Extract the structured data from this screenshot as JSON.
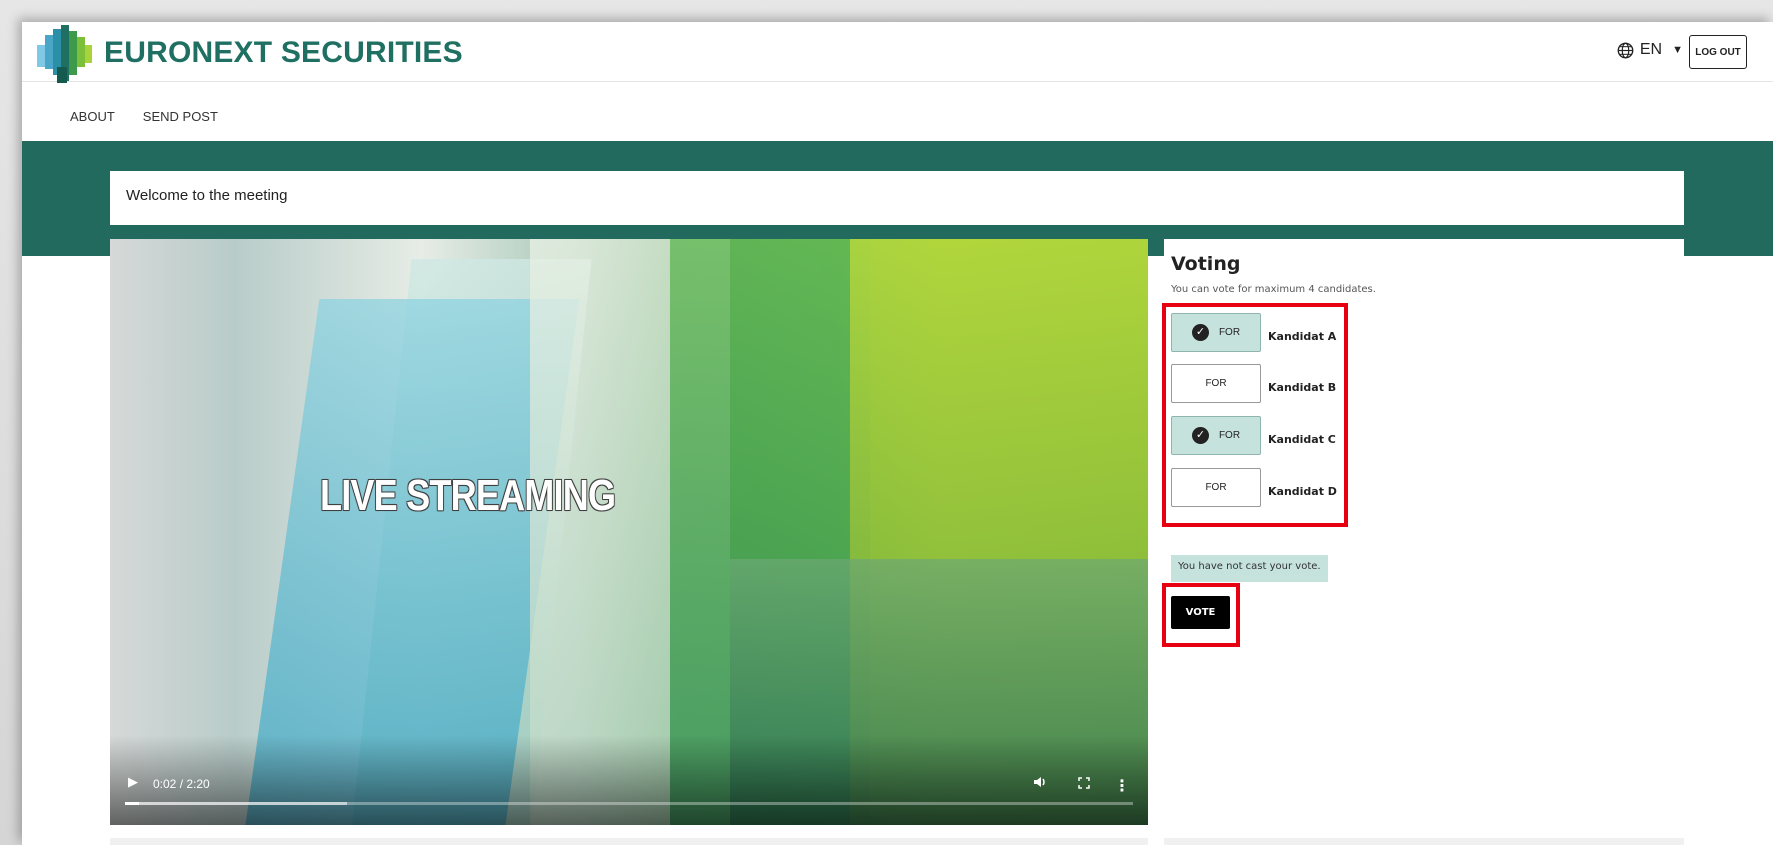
{
  "brand": {
    "name": "EURONEXT SECURITIES",
    "color": "#1f6f62"
  },
  "header": {
    "language": "EN",
    "logout_label": "LOG OUT"
  },
  "nav": {
    "items": [
      "ABOUT",
      "SEND POST"
    ]
  },
  "welcome": {
    "text": "Welcome to the meeting"
  },
  "video": {
    "overlay_text": "LIVE STREAMING",
    "time": "0:02 / 2:20",
    "progress": 0.0143,
    "buffered": 0.22
  },
  "voting": {
    "title": "Voting",
    "subtitle": "You can vote for maximum 4 candidates.",
    "candidates": [
      {
        "name": "Kandidat A",
        "button_label": "FOR",
        "selected": true
      },
      {
        "name": "Kandidat B",
        "button_label": "FOR",
        "selected": false
      },
      {
        "name": "Kandidat C",
        "button_label": "FOR",
        "selected": true
      },
      {
        "name": "Kandidat D",
        "button_label": "FOR",
        "selected": false
      }
    ],
    "status": "You have not cast your vote.",
    "vote_label": "VOTE"
  },
  "colors": {
    "teal": "#22695e",
    "selected_bg": "#c5e2dd",
    "highlight": "#e60012"
  }
}
